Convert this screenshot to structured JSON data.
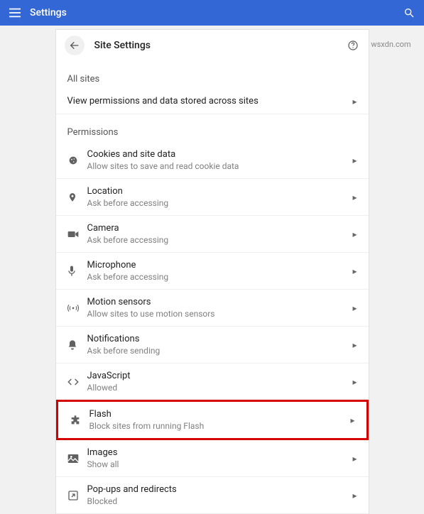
{
  "topbar": {
    "title": "Settings"
  },
  "header": {
    "page_title": "Site Settings"
  },
  "sections": {
    "all_sites_label": "All sites",
    "view_permissions_label": "View permissions and data stored across sites",
    "permissions_label": "Permissions"
  },
  "rows": {
    "cookies": {
      "label": "Cookies and site data",
      "sub": "Allow sites to save and read cookie data"
    },
    "location": {
      "label": "Location",
      "sub": "Ask before accessing"
    },
    "camera": {
      "label": "Camera",
      "sub": "Ask before accessing"
    },
    "microphone": {
      "label": "Microphone",
      "sub": "Ask before accessing"
    },
    "motion": {
      "label": "Motion sensors",
      "sub": "Allow sites to use motion sensors"
    },
    "notifications": {
      "label": "Notifications",
      "sub": "Ask before sending"
    },
    "javascript": {
      "label": "JavaScript",
      "sub": "Allowed"
    },
    "flash": {
      "label": "Flash",
      "sub": "Block sites from running Flash"
    },
    "images": {
      "label": "Images",
      "sub": "Show all"
    },
    "popups": {
      "label": "Pop-ups and redirects",
      "sub": "Blocked"
    }
  },
  "watermark": "wsxdn.com"
}
